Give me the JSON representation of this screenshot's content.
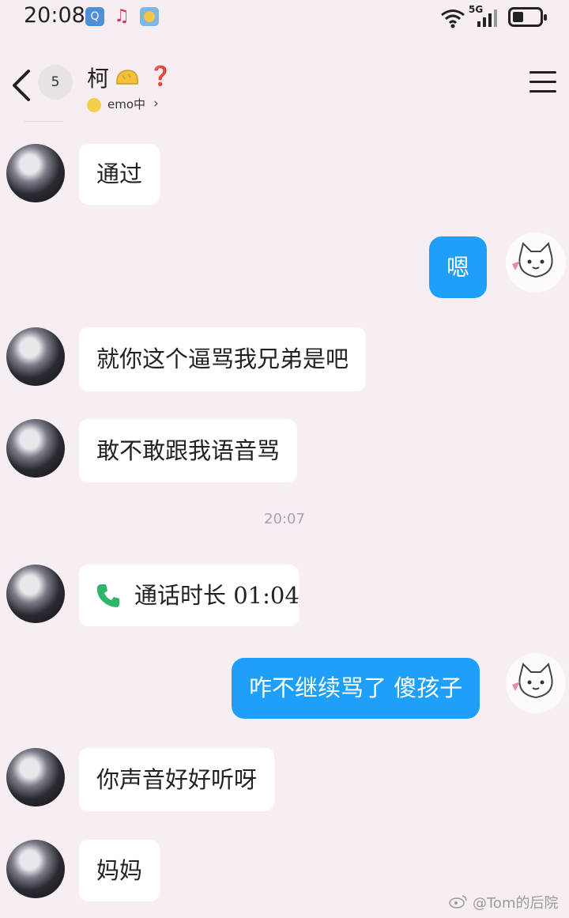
{
  "status_bar": {
    "time": "20:08",
    "network": "5G",
    "icons": [
      "qq-icon",
      "music-icon",
      "weather-icon",
      "wifi-icon",
      "signal-icon",
      "battery-icon"
    ]
  },
  "header": {
    "unread_count": "5",
    "contact_name": "柯",
    "status_text": "emo中",
    "icons": [
      "back-icon",
      "bread-icon",
      "ear-icon",
      "menu-icon"
    ]
  },
  "messages": [
    {
      "side": "left",
      "text": "通过"
    },
    {
      "side": "right",
      "text": "嗯"
    },
    {
      "side": "left",
      "text": "就你这个逼骂我兄弟是吧"
    },
    {
      "side": "left",
      "text": "敢不敢跟我语音骂"
    },
    {
      "type": "time",
      "text": "20:07"
    },
    {
      "side": "left",
      "type": "call",
      "text": "通话时长 01:04"
    },
    {
      "side": "right",
      "text": "咋不继续骂了 傻孩子"
    },
    {
      "side": "left",
      "text": "你声音好好听呀"
    },
    {
      "side": "left",
      "text": "妈妈"
    }
  ],
  "watermark": "@Tom的后院",
  "colors": {
    "background": "#f7eef4",
    "sent_bubble": "#1ea0fa",
    "received_bubble": "#ffffff",
    "call_icon": "#2fb56a"
  }
}
